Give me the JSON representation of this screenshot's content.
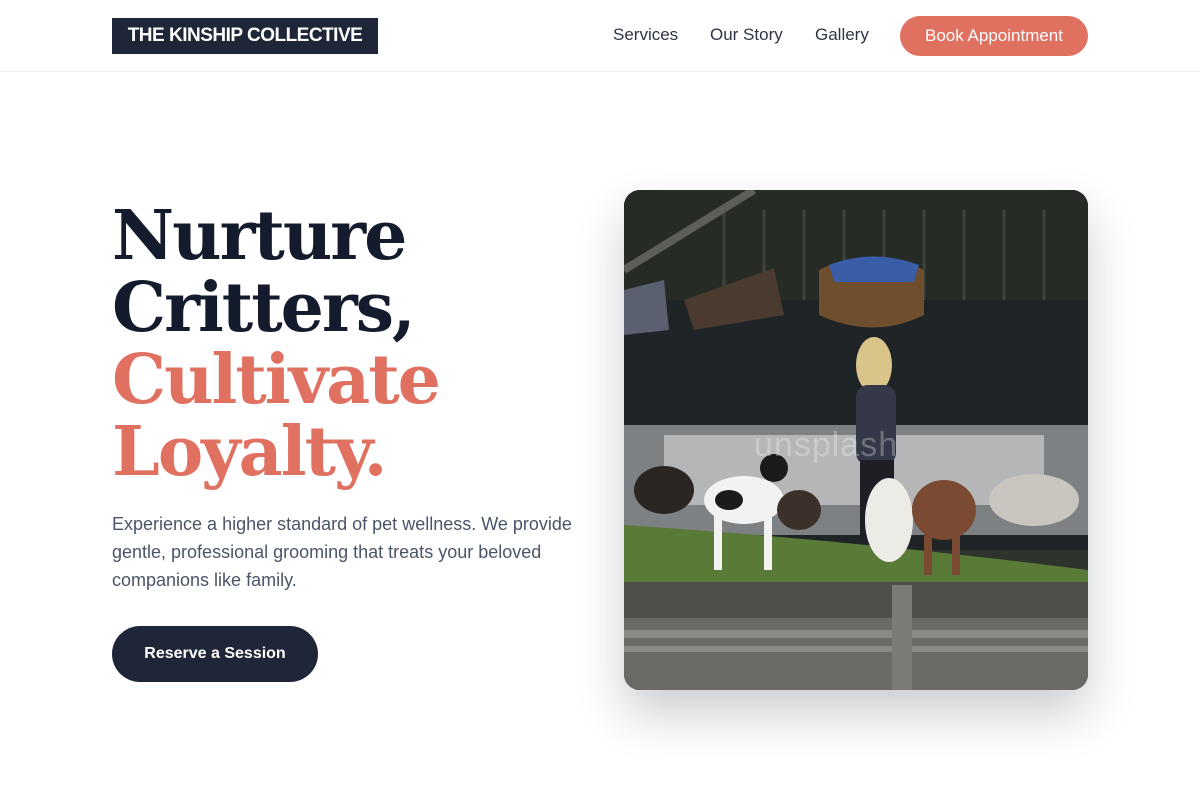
{
  "brand": {
    "name": "THE KINSHIP COLLECTIVE"
  },
  "nav": {
    "links": [
      "Services",
      "Our Story",
      "Gallery"
    ],
    "cta_label": "Book Appointment"
  },
  "hero": {
    "headline_line1": "Nurture",
    "headline_line2": "Critters,",
    "headline_line3": "Cultivate",
    "headline_line4": "Loyalty.",
    "description": "Experience a higher standard of pet wellness. We provide gentle, professional grooming that treats your beloved companions like family.",
    "button_label": "Reserve a Session",
    "image_watermark": "unsplash"
  },
  "colors": {
    "navy": "#1e2638",
    "coral": "#e07060",
    "text_muted": "#4a5568"
  }
}
